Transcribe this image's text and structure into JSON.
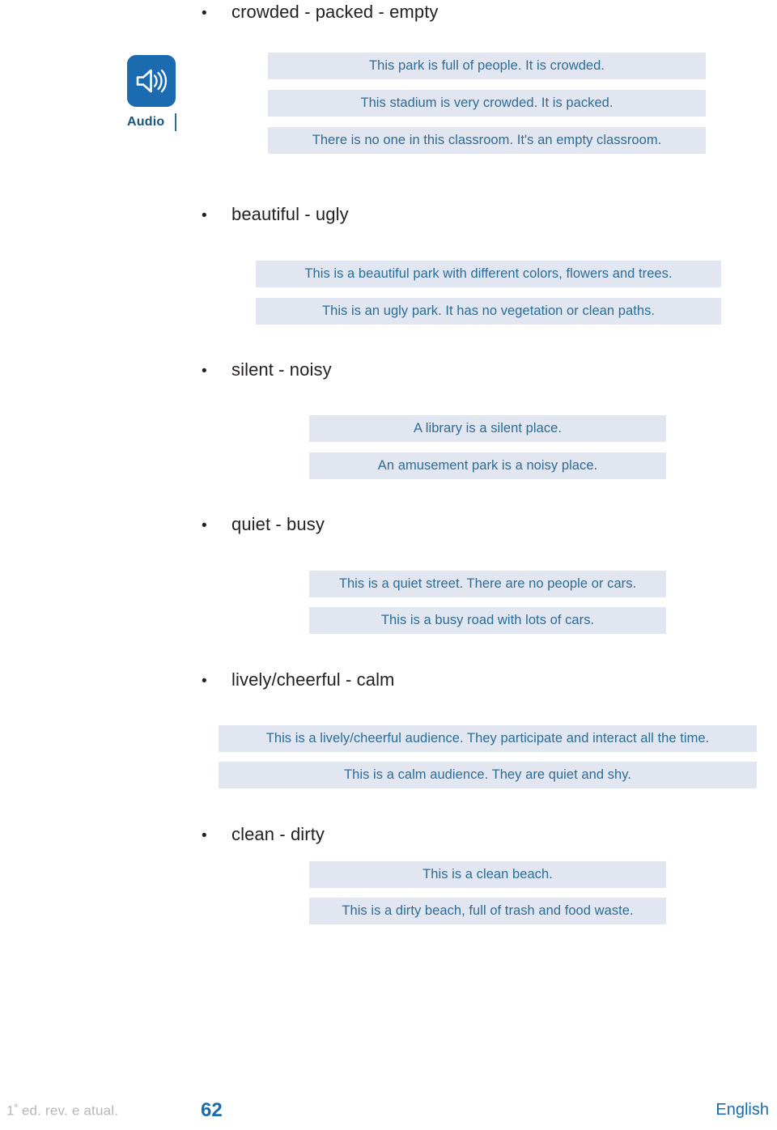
{
  "audio": {
    "icon": "speaker-audio-icon",
    "caption": "Audio"
  },
  "groups": [
    {
      "heading": "crowded - packed - empty",
      "bullet": "•",
      "sentences": [
        "This park is full of people. It is crowded.",
        "This stadium is very crowded. It is packed.",
        "There is no one in this classroom. It's an empty classroom."
      ]
    },
    {
      "heading": "beautiful - ugly",
      "bullet": "•",
      "sentences": [
        "This is a beautiful park with different colors, flowers and trees.",
        "This is an ugly park. It has no vegetation or clean paths."
      ]
    },
    {
      "heading": "silent - noisy",
      "bullet": "•",
      "sentences": [
        "A library is a silent place.",
        "An amusement park is a noisy place."
      ]
    },
    {
      "heading": "quiet - busy",
      "bullet": "•",
      "sentences": [
        "This is a quiet street. There are no people or cars.",
        "This is a busy road with lots of cars."
      ]
    },
    {
      "heading": "lively/cheerful - calm",
      "bullet": "•",
      "sentences": [
        "This is a lively/cheerful audience. They participate and interact all the time.",
        "This is a calm audience. They are quiet and shy."
      ]
    },
    {
      "heading": "clean - dirty",
      "bullet": "•",
      "sentences": [
        "This is a clean beach.",
        "This is a dirty beach, full of trash and food waste."
      ]
    }
  ],
  "footer": {
    "edition_prefix": "1",
    "edition_sup": "ª",
    "edition_rest": " ed. rev. e atual.",
    "page_number": "62",
    "language": "English"
  },
  "colors": {
    "strip_bg": "#e2e6f0",
    "strip_text": "#2b6d99",
    "heading_text": "#231f20",
    "accent_blue": "#1a6bb0",
    "footer_grey": "#b7b7b7"
  }
}
